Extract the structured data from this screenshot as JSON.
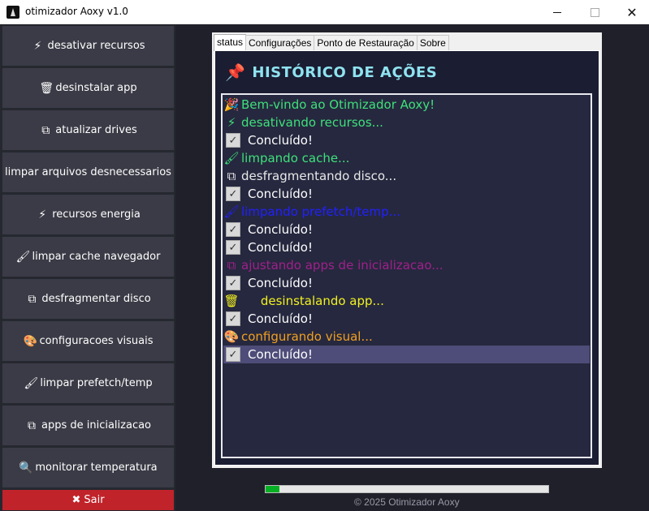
{
  "window": {
    "title": "otimizador Aoxy v1.0",
    "close_glyph": "✕"
  },
  "sidebar": {
    "buttons": [
      {
        "icon": "⚡",
        "icon_name": "lightning-icon",
        "label": "desativar recursos"
      },
      {
        "icon": "🗑",
        "icon_name": "trash-icon",
        "label": "desinstalar app"
      },
      {
        "icon": "⧉",
        "icon_name": "driver-icon",
        "label": "atualizar drives"
      },
      {
        "icon": "",
        "icon_name": "",
        "label": "limpar arquivos desnecessarios"
      },
      {
        "icon": "⚡",
        "icon_name": "lightning-icon",
        "label": "recursos energia"
      },
      {
        "icon": "🖌",
        "icon_name": "brush-icon",
        "label": "limpar cache navegador"
      },
      {
        "icon": "⧉",
        "icon_name": "disk-icon",
        "label": "desfragmentar disco"
      },
      {
        "icon": "🎨",
        "icon_name": "palette-icon",
        "label": "configuracoes visuais"
      },
      {
        "icon": "🖌",
        "icon_name": "brush-icon",
        "label": "limpar prefetch/temp"
      },
      {
        "icon": "⧉",
        "icon_name": "startup-apps-icon",
        "label": "apps de inicializacao"
      },
      {
        "icon": "🔍",
        "icon_name": "magnifier-icon",
        "label": "monitorar temperatura"
      }
    ],
    "exit": {
      "icon": "✖",
      "label": "Sair"
    }
  },
  "tabs": [
    "status",
    "Configurações",
    "Ponto de Restauração",
    "Sobre"
  ],
  "active_tab": "status",
  "history": {
    "title": "HISTÓRICO DE AÇÕES",
    "pin_icon": "📌",
    "lines": [
      {
        "icon": "🎉",
        "text": "Bem-vindo ao Otimizador Aoxy!",
        "color": "#3ee07a"
      },
      {
        "icon": "⚡",
        "text": "desativando recursos...",
        "color": "#3ee07a"
      },
      {
        "check": "✓",
        "text": "Concluído!",
        "color": "#ffffff"
      },
      {
        "icon": "🖌",
        "text": "limpando cache...",
        "color": "#3ee07a"
      },
      {
        "icon": "⧉",
        "text": "desfragmentando disco...",
        "color": "#e8e8e8"
      },
      {
        "check": "✓",
        "text": "Concluído!",
        "color": "#ffffff"
      },
      {
        "icon": "🖌",
        "text": "limpando prefetch/temp...",
        "color": "#2020ff"
      },
      {
        "check": "✓",
        "text": "Concluído!",
        "color": "#ffffff"
      },
      {
        "check": "✓",
        "text": "Concluído!",
        "color": "#ffffff"
      },
      {
        "icon": "⧉",
        "text": "ajustando apps de inicializacao...",
        "color": "#a0208a"
      },
      {
        "check": "✓",
        "text": "Concluído!",
        "color": "#ffffff"
      },
      {
        "icon": "🗑",
        "text": "     desinstalando app...",
        "color": "#f0f020"
      },
      {
        "check": "✓",
        "text": "Concluído!",
        "color": "#ffffff"
      },
      {
        "icon": "🎨",
        "text": "configurando visual...",
        "color": "#f0a020"
      },
      {
        "check": "✓",
        "text": "Concluído!",
        "color": "#ffffff",
        "selected": true
      }
    ]
  },
  "progress": {
    "fraction": 0.05,
    "color": "#06b025"
  },
  "footer": "© 2025 Otimizador Aoxy"
}
